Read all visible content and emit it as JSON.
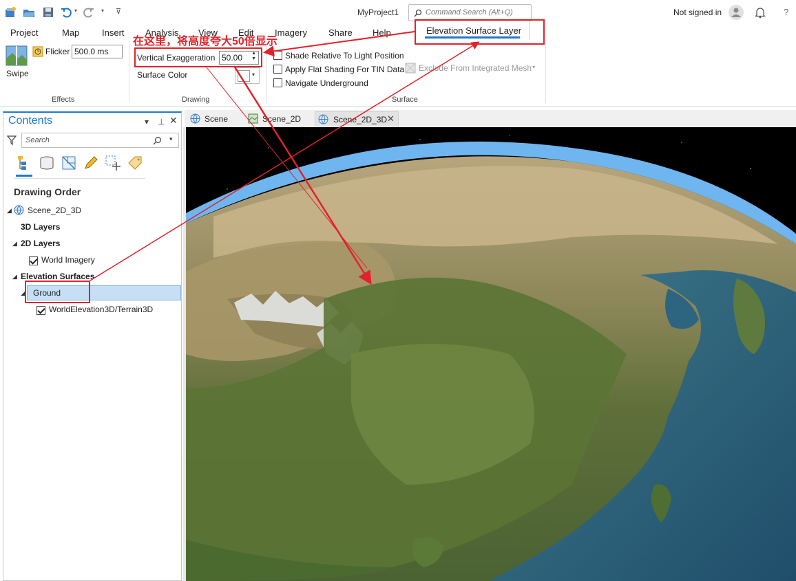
{
  "titlebar": {
    "project_title": "MyProject1",
    "command_search_placeholder": "Command Search (Alt+Q)",
    "signin_text": "Not signed in",
    "help_glyph": "?"
  },
  "ribbon_tabs": [
    {
      "label": "Project"
    },
    {
      "label": "Map"
    },
    {
      "label": "Insert"
    },
    {
      "label": "Analysis"
    },
    {
      "label": "View"
    },
    {
      "label": "Edit"
    },
    {
      "label": "Imagery"
    },
    {
      "label": "Share"
    },
    {
      "label": "Help"
    },
    {
      "label": "Elevation Surface Layer",
      "active": true
    }
  ],
  "ribbon": {
    "effects": {
      "swipe_label": "Swipe",
      "flicker_label": "Flicker",
      "flicker_value": "500.0 ms",
      "group_label": "Effects"
    },
    "drawing": {
      "vertical_exaggeration_label": "Vertical Exaggeration",
      "vertical_exaggeration_value": "50.00",
      "surface_color_label": "Surface Color",
      "group_label": "Drawing"
    },
    "surface": {
      "shade_relative": "Shade Relative To Light Position",
      "flat_shading": "Apply Flat Shading For TIN Data",
      "navigate_underground": "Navigate Underground",
      "exclude_mesh": "Exclude From Integrated Mesh",
      "group_label": "Surface"
    }
  },
  "annotation": {
    "text": "在这里，将高度夸大50倍显示",
    "color": "#e0232b"
  },
  "contents": {
    "title": "Contents",
    "search_placeholder": "Search",
    "drawing_order": "Drawing Order",
    "tree": {
      "scene_name": "Scene_2D_3D",
      "layers_3d": "3D Layers",
      "layers_2d": "2D Layers",
      "world_imagery": "World Imagery",
      "elevation_surfaces": "Elevation Surfaces",
      "ground": "Ground",
      "terrain": "WorldElevation3D/Terrain3D"
    }
  },
  "view_tabs": [
    {
      "label": "Scene"
    },
    {
      "label": "Scene_2D"
    },
    {
      "label": "Scene_2D_3D",
      "active": true
    }
  ],
  "colors": {
    "accent": "#1e78c8",
    "annotation_red": "#e0232b",
    "selection": "#c7dff5"
  }
}
